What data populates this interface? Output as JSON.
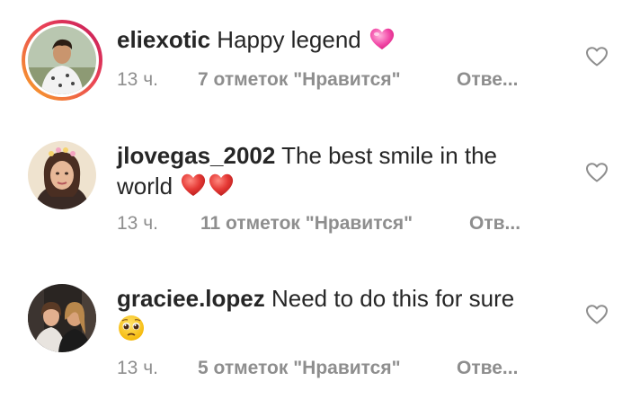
{
  "comments": [
    {
      "username": "eliexotic",
      "text": "Happy legend",
      "emoji": "pink-heart",
      "time": "13 ч.",
      "likes": "7 отметок \"Нравится\"",
      "reply": "Отве..."
    },
    {
      "username": "jlovegas_2002",
      "text": "The best smile in the world",
      "emoji": "two-red-hearts",
      "time": "13 ч.",
      "likes": "11 отметок \"Нравится\"",
      "reply": "Отв..."
    },
    {
      "username": "graciee.lopez",
      "text": "Need to do this for sure",
      "emoji": "pleading-face",
      "time": "13 ч.",
      "likes": "5 отметок \"Нравится\"",
      "reply": "Отве..."
    }
  ],
  "colors": {
    "story_ring_start": "#f9a825",
    "story_ring_end": "#d81b60",
    "meta_text": "#8e8e8e",
    "body_text": "#262626"
  }
}
